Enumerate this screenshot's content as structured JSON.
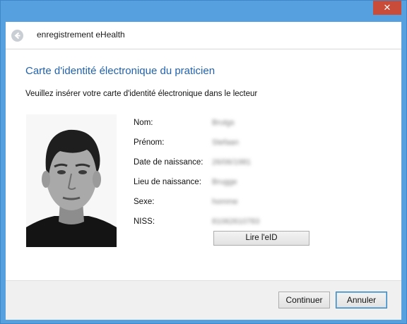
{
  "window": {
    "title": "enregistrement eHealth",
    "close_label": "✕"
  },
  "page": {
    "title": "Carte d'identité électronique du praticien",
    "instruction": "Veuillez insérer votre carte d'identité électronique dans le lecteur"
  },
  "fields": [
    {
      "label": "Nom:",
      "value": "Brutgs"
    },
    {
      "label": "Prénom:",
      "value": "Stefaan"
    },
    {
      "label": "Date de naissance:",
      "value": "26/06/1981"
    },
    {
      "label": "Lieu de naissance:",
      "value": "Brugge"
    },
    {
      "label": "Sexe:",
      "value": "homme"
    },
    {
      "label": "NISS:",
      "value": "81062610783"
    }
  ],
  "buttons": {
    "read_eid": "Lire l'eID",
    "continue": "Continuer",
    "cancel": "Annuler"
  },
  "colors": {
    "titlebar": "#56a0e0",
    "close": "#c94b3a",
    "title_text": "#1f62b3"
  },
  "icons": {
    "back": "back-arrow-icon",
    "close": "close-icon",
    "photo": "id-photo"
  }
}
